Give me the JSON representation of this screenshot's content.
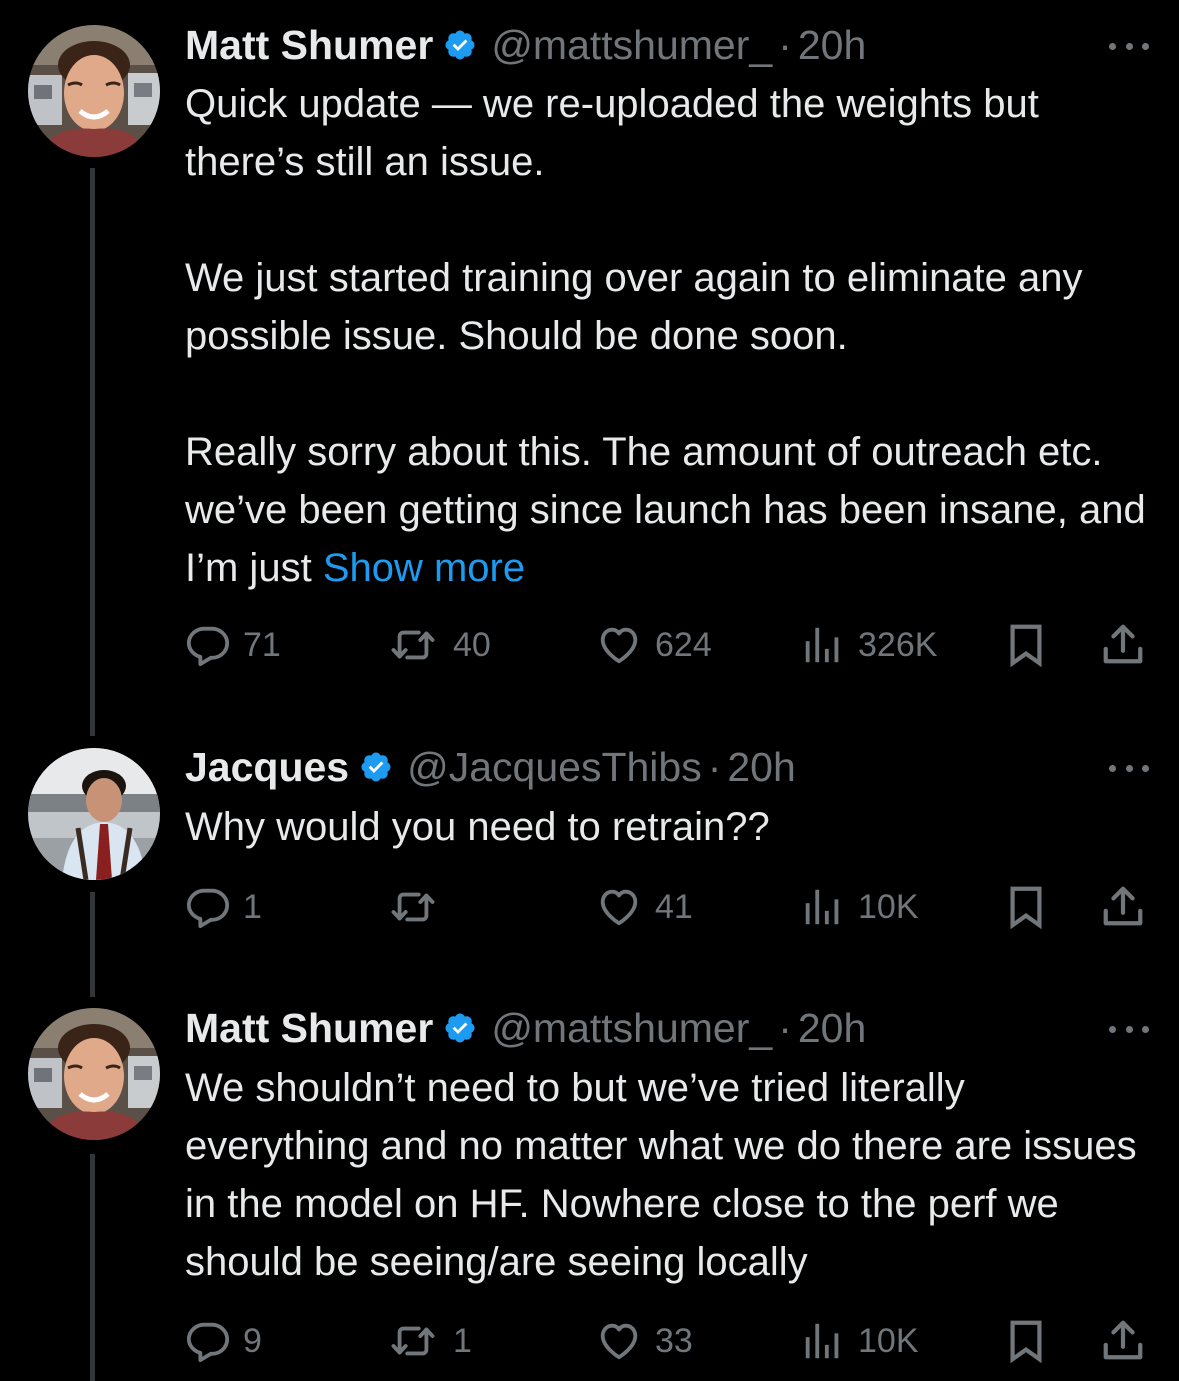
{
  "tweets": [
    {
      "name": "Matt Shumer",
      "handle": "@mattshumer_",
      "time": "20h",
      "body": [
        "Quick update — we re-uploaded the weights but there’s still an issue.",
        "We just started training over again to eliminate any possible issue. Should be done soon.",
        "Really sorry about this. The amount of outreach etc. we’ve been getting since launch has been insane, and I’m just"
      ],
      "show_more": "Show more",
      "replies": "71",
      "reposts": "40",
      "likes": "624",
      "views": "326K"
    },
    {
      "name": "Jacques",
      "handle": "@JacquesThibs",
      "time": "20h",
      "body": [
        "Why would you need to retrain??"
      ],
      "replies": "1",
      "reposts": "",
      "likes": "41",
      "views": "10K"
    },
    {
      "name": "Matt Shumer",
      "handle": "@mattshumer_",
      "time": "20h",
      "body": [
        "We shouldn’t need to but we’ve tried literally everything and no matter what we do there are issues in the model on HF. Nowhere close to the perf we should be seeing/are seeing locally"
      ],
      "replies": "9",
      "reposts": "1",
      "likes": "33",
      "views": "10K"
    }
  ],
  "separator": "·",
  "icons": [
    "verified-badge-icon",
    "more-icon",
    "reply-icon",
    "repost-icon",
    "like-icon",
    "views-icon",
    "bookmark-icon",
    "share-icon"
  ],
  "colors": {
    "background": "#000000",
    "text": "#e7e9ea",
    "secondary": "#71767b",
    "accent": "#1d9bf0",
    "thread_line": "#333639"
  }
}
